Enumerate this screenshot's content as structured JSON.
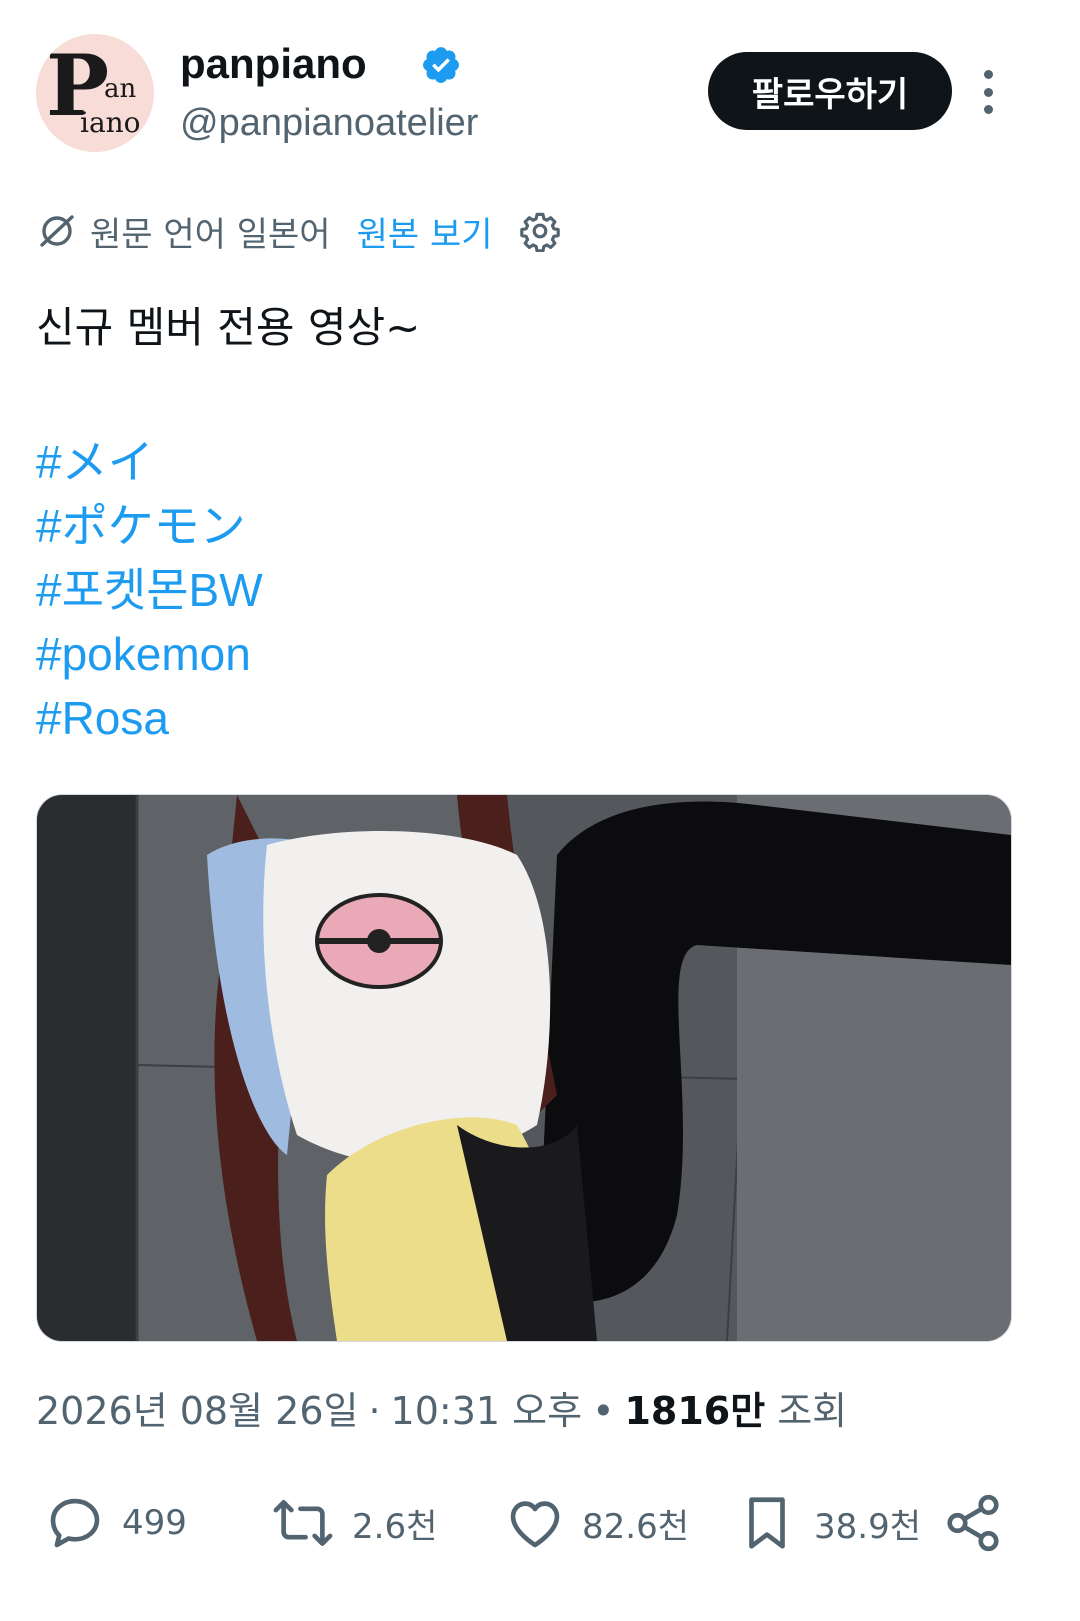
{
  "author": {
    "avatar_text": {
      "p": "P",
      "an": "an",
      "iano": "iano"
    },
    "display_name": "panpiano",
    "handle": "@panpianoatelier",
    "verified": true
  },
  "follow_button": {
    "label": "팔로우하기"
  },
  "translation": {
    "language_note": "원문 언어 일본어",
    "show_original": "원본 보기"
  },
  "tweet": {
    "text": "신규 멤버 전용 영상~",
    "hashtags": [
      "#メイ",
      "#ポケモン",
      "#포켓몬BW",
      "#pokemon",
      "#Rosa"
    ]
  },
  "meta": {
    "date": "2026년 08월 26일",
    "time": "10:31 오후",
    "views_count": "1816만",
    "views_label": "조회"
  },
  "actions": {
    "replies": "499",
    "reposts": "2.6천",
    "likes": "82.6천",
    "bookmarks": "38.9천"
  },
  "colors": {
    "link": "#1d9bf0",
    "text": "#0f1419",
    "secondary": "#536471",
    "button_bg": "#0f1419"
  },
  "icons": [
    "verified-badge-icon",
    "translate-icon",
    "gear-icon",
    "more-icon",
    "reply-icon",
    "repost-icon",
    "like-icon",
    "bookmark-icon",
    "share-icon"
  ]
}
